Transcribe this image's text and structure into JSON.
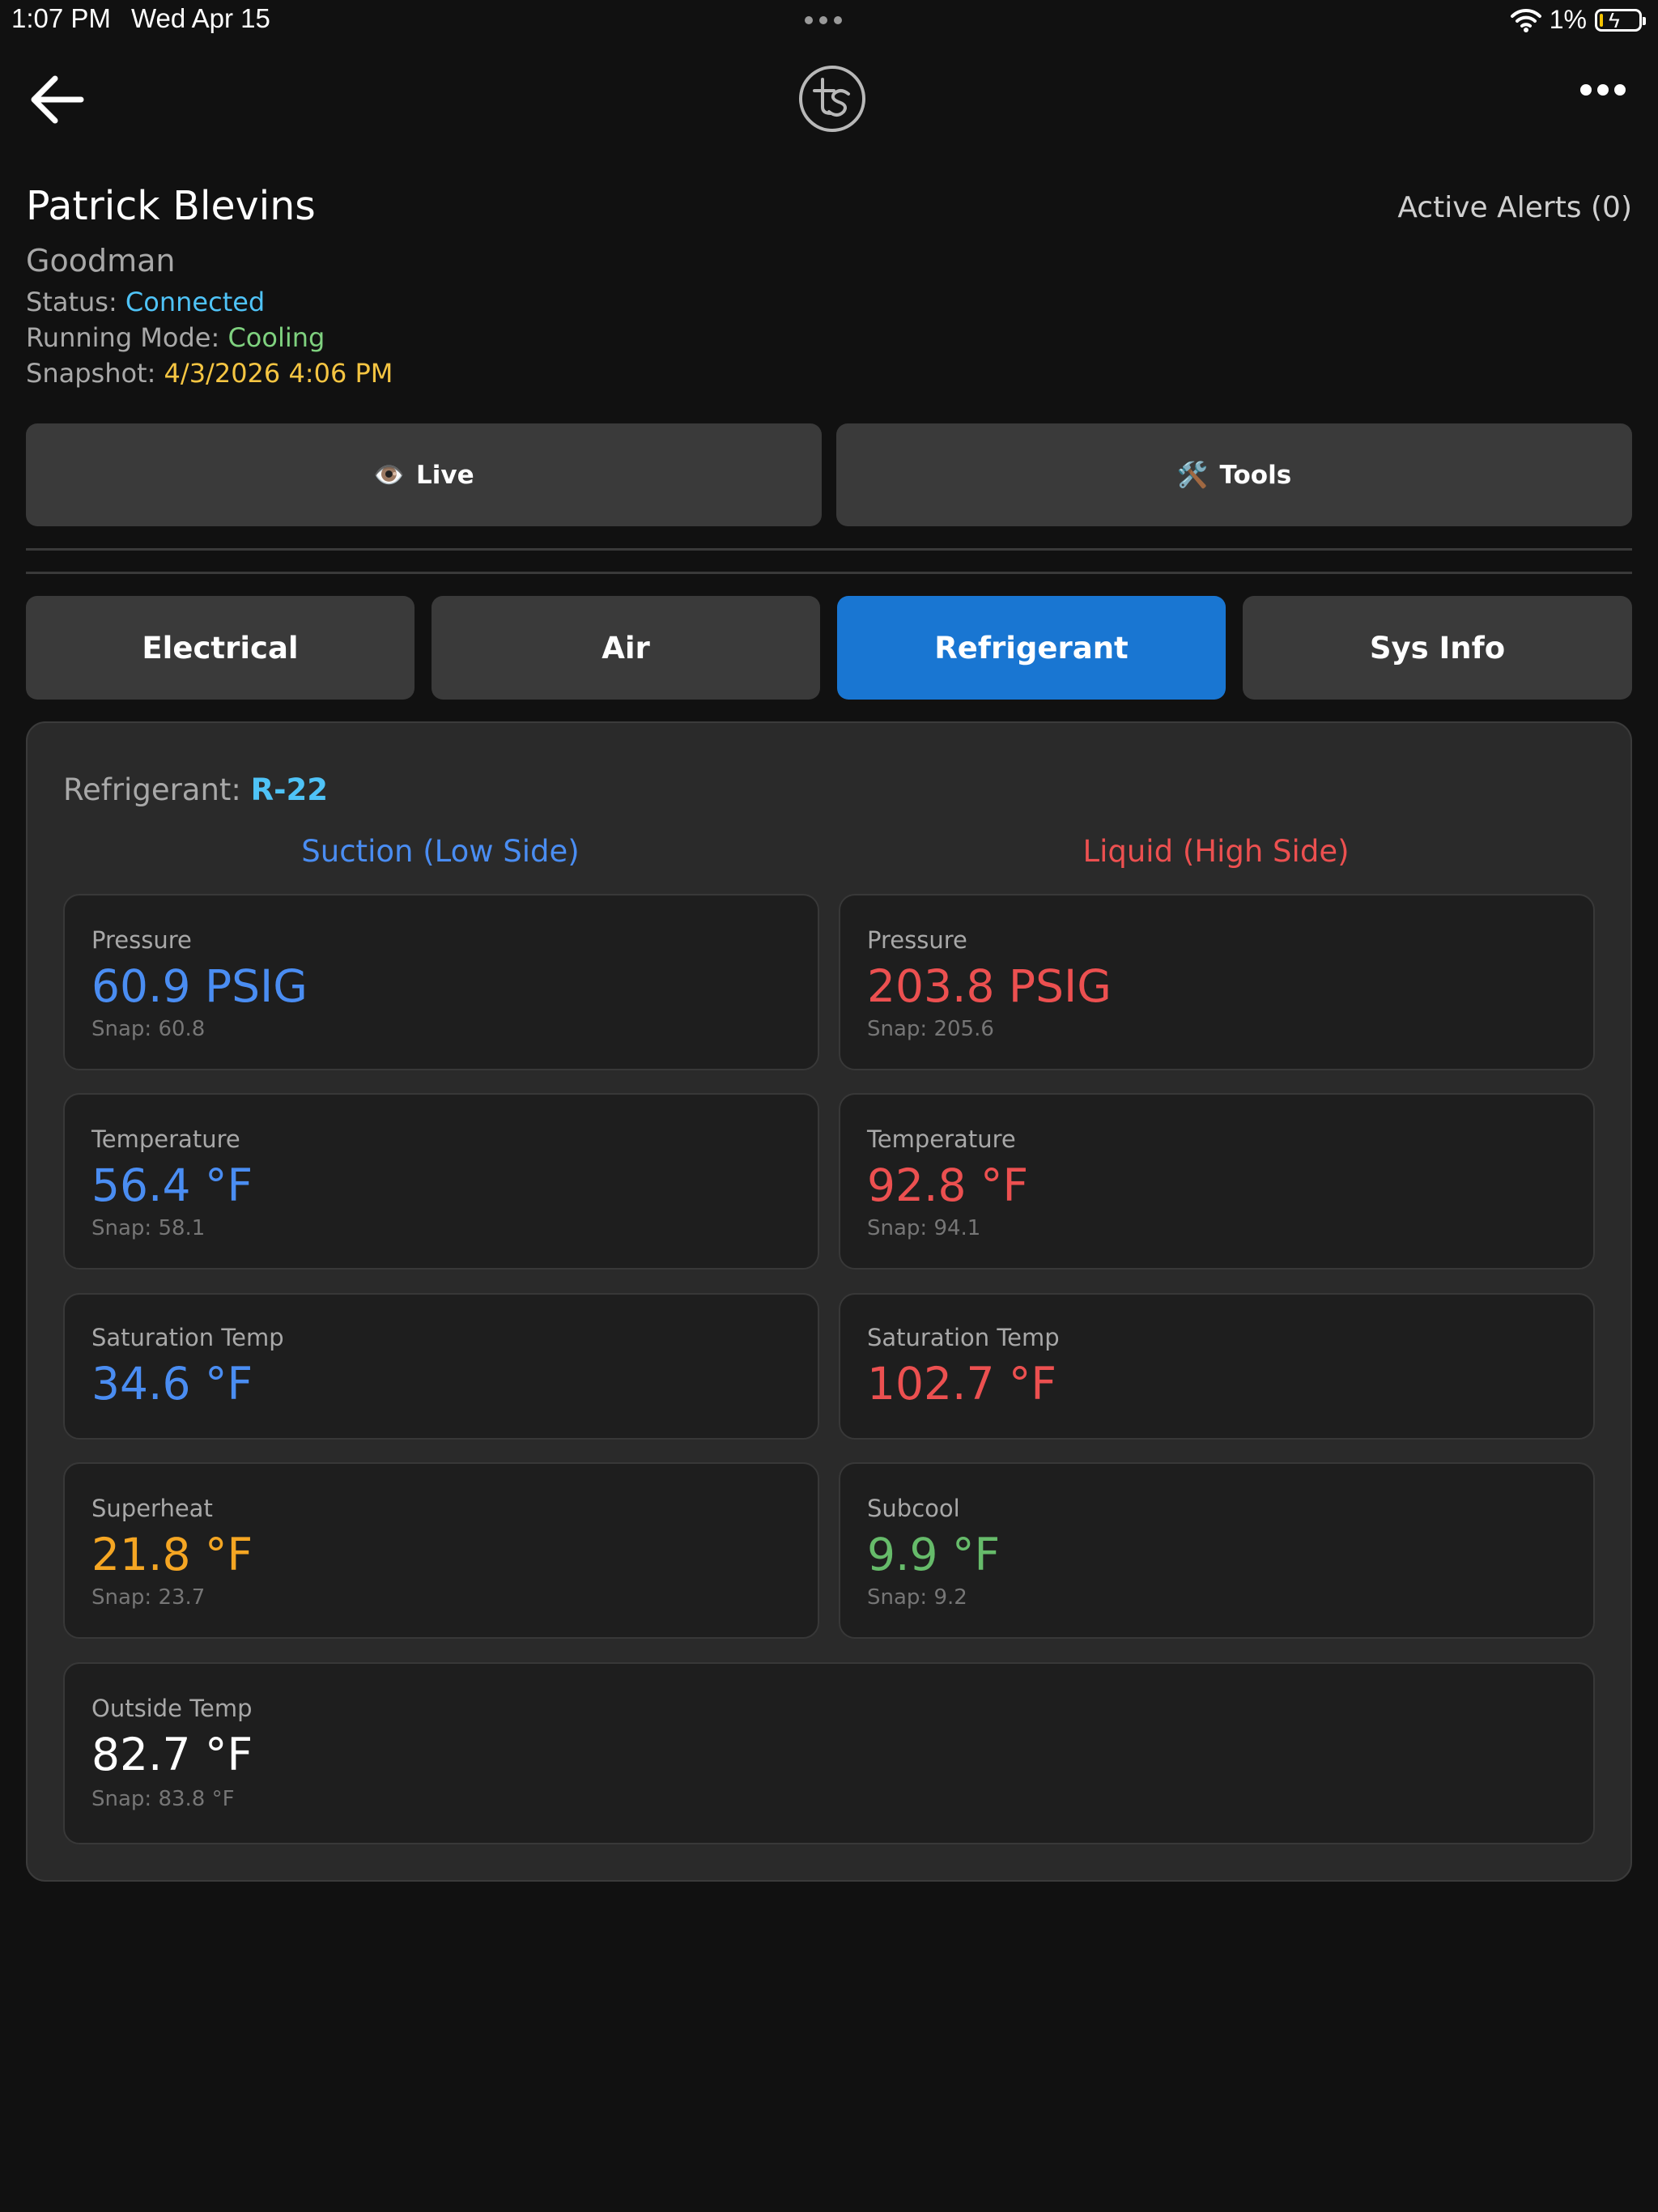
{
  "status_bar": {
    "time": "1:07 PM",
    "date": "Wed Apr 15",
    "battery": "1%",
    "battery_level": 0.01,
    "icons": [
      "multitask-dots-icon",
      "wifi-icon",
      "battery-charging-icon"
    ]
  },
  "nav": {
    "back_icon": "arrow-left-icon",
    "logo_text": "ts",
    "more_icon": "ellipsis-icon"
  },
  "header": {
    "customer_name": "Patrick Blevins",
    "active_alerts": "Active Alerts (0)",
    "brand": "Goodman",
    "status_label": "Status: ",
    "status_value": "Connected",
    "mode_label": "Running Mode: ",
    "mode_value": "Cooling",
    "snapshot_label": "Snapshot: ",
    "snapshot_value": "4/3/2026 4:06 PM"
  },
  "actions": {
    "live_icon": "👁️",
    "live_label": "Live",
    "tools_icon": "🛠️",
    "tools_label": "Tools"
  },
  "tabs": [
    {
      "label": "Electrical",
      "active": false
    },
    {
      "label": "Air",
      "active": false
    },
    {
      "label": "Refrigerant",
      "active": true
    },
    {
      "label": "Sys Info",
      "active": false
    }
  ],
  "refrigerant": {
    "label": "Refrigerant: ",
    "type": "R-22",
    "low_side": {
      "title": "Suction (Low Side)",
      "pressure": {
        "label": "Pressure",
        "value": "60.9 PSIG",
        "snap": "Snap: 60.8"
      },
      "temperature": {
        "label": "Temperature",
        "value": "56.4 °F",
        "snap": "Snap: 58.1"
      },
      "saturation": {
        "label": "Saturation Temp",
        "value": "34.6 °F"
      },
      "superheat": {
        "label": "Superheat",
        "value": "21.8 °F",
        "snap": "Snap: 23.7"
      }
    },
    "high_side": {
      "title": "Liquid (High Side)",
      "pressure": {
        "label": "Pressure",
        "value": "203.8 PSIG",
        "snap": "Snap: 205.6"
      },
      "temperature": {
        "label": "Temperature",
        "value": "92.8 °F",
        "snap": "Snap: 94.1"
      },
      "saturation": {
        "label": "Saturation Temp",
        "value": "102.7 °F"
      },
      "subcool": {
        "label": "Subcool",
        "value": "9.9 °F",
        "snap": "Snap: 9.2"
      }
    },
    "outside": {
      "label": "Outside Temp",
      "value": "82.7 °F",
      "snap": "Snap: 83.8 °F"
    }
  },
  "colors": {
    "background": "#111111",
    "accent_tab": "#1976d2",
    "connected": "#4fc3f7",
    "cooling": "#7fd17f",
    "snapshot": "#f5c542",
    "low_side": "#4a8df2",
    "high_side": "#ec5050",
    "superheat": "#f5a623",
    "subcool": "#66bb6a"
  }
}
